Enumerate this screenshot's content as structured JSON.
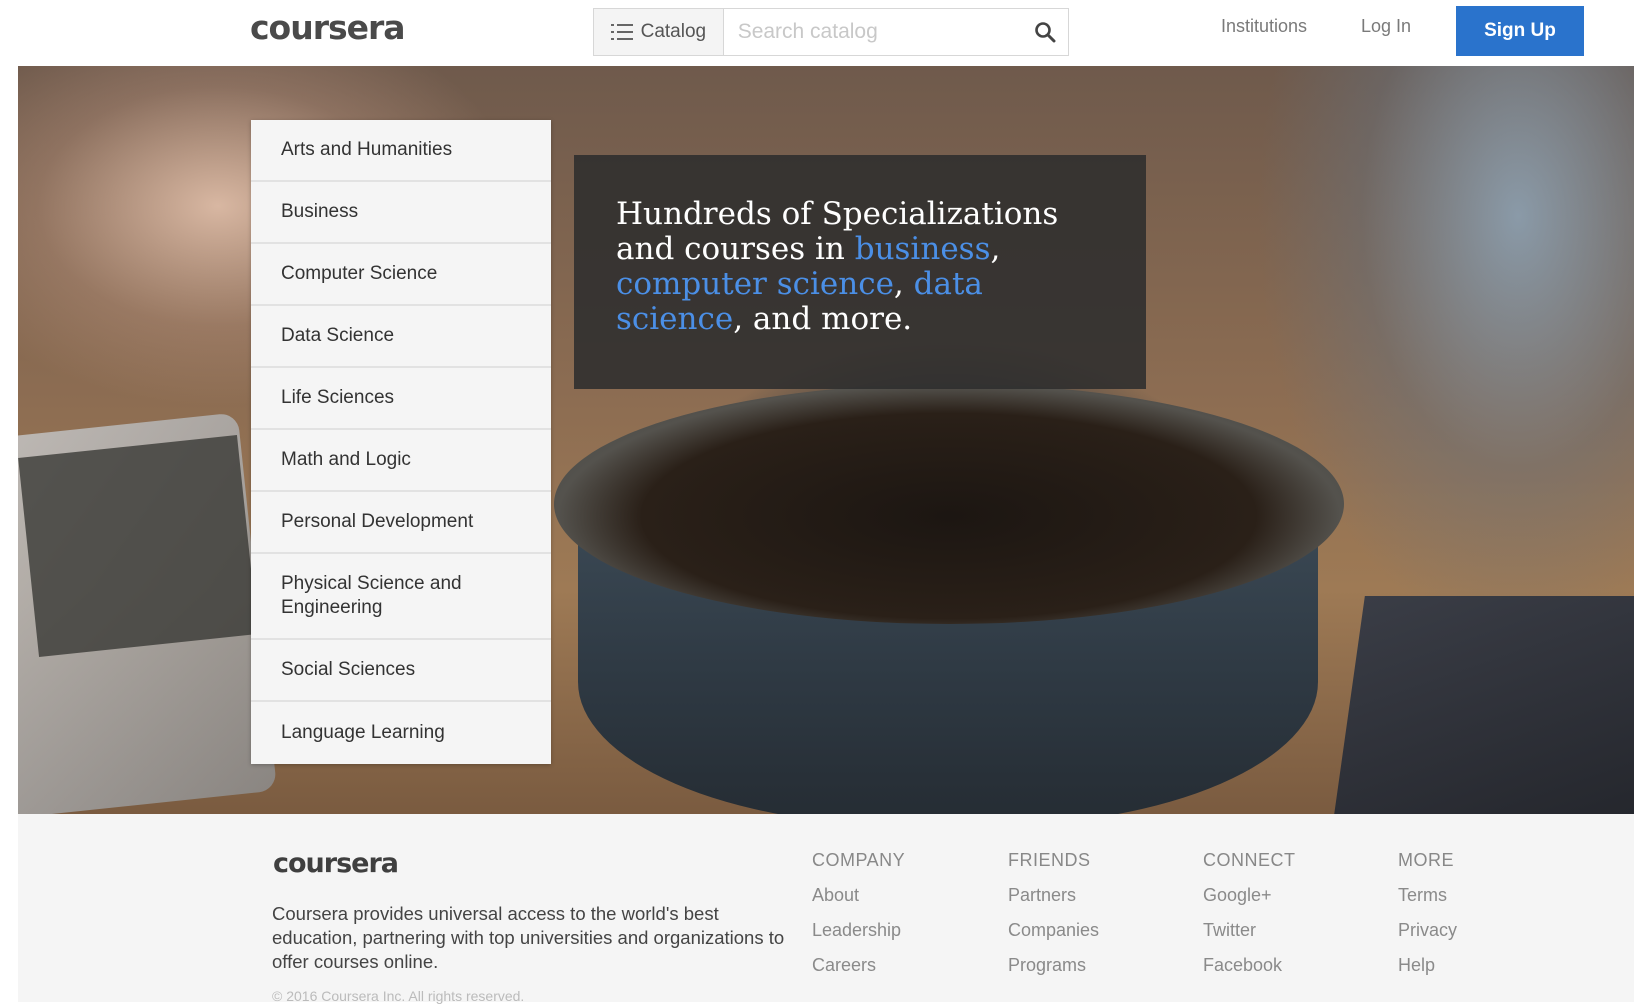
{
  "header": {
    "logo": "coursera",
    "catalog_label": "Catalog",
    "search_placeholder": "Search catalog",
    "institutions_label": "Institutions",
    "login_label": "Log In",
    "signup_label": "Sign Up"
  },
  "categories": [
    "Arts and Humanities",
    "Business",
    "Computer Science",
    "Data Science",
    "Life Sciences",
    "Math and Logic",
    "Personal Development",
    "Physical Science and Engineering",
    "Social Sciences",
    "Language Learning"
  ],
  "tagline": {
    "prefix": "Hundreds of Specializations and courses in ",
    "link1": "business",
    "sep1": ", ",
    "link2": "computer science",
    "sep2": ", ",
    "link3": "data science",
    "suffix": ", and more."
  },
  "footer": {
    "logo": "coursera",
    "description": "Coursera provides universal access to the world's best education, partnering with top universities and organizations to offer courses online.",
    "copyright": "© 2016 Coursera Inc. All rights reserved.",
    "columns": [
      {
        "title": "COMPANY",
        "links": [
          "About",
          "Leadership",
          "Careers"
        ]
      },
      {
        "title": "FRIENDS",
        "links": [
          "Partners",
          "Companies",
          "Programs"
        ]
      },
      {
        "title": "CONNECT",
        "links": [
          "Google+",
          "Twitter",
          "Facebook"
        ]
      },
      {
        "title": "MORE",
        "links": [
          "Terms",
          "Privacy",
          "Help"
        ]
      }
    ]
  },
  "colors": {
    "accent": "#2a73cc",
    "link": "#4b8fe6"
  }
}
